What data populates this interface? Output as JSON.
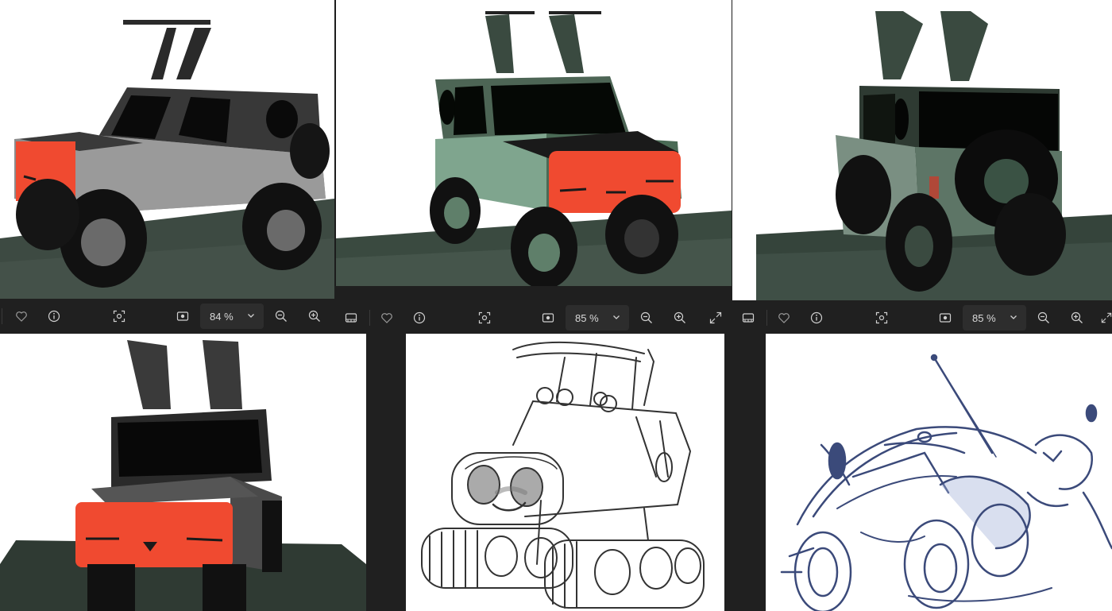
{
  "windows": [
    {
      "id": "top-left",
      "zoom_value": "84 %"
    },
    {
      "id": "top-mid",
      "zoom_value": "85 %"
    },
    {
      "id": "top-right",
      "zoom_value": "85 %"
    }
  ],
  "icons": {
    "filmstrip": "filmstrip-icon",
    "favorite": "heart-icon",
    "info": "info-icon",
    "focus": "focus-frame-icon",
    "actual_size": "actual-size-icon",
    "zoom_out": "zoom-out-icon",
    "zoom_in": "zoom-in-icon",
    "expand": "expand-icon",
    "dropdown": "chevron-down-icon"
  },
  "colors": {
    "toolbar_bg": "#202020",
    "zoom_bg": "#2d2d2d",
    "icon": "#cfcfcf",
    "face_red": "#f04a30"
  }
}
